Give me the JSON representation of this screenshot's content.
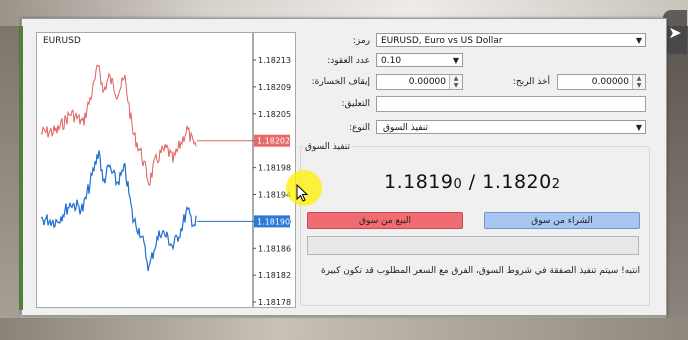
{
  "window": {
    "chart": {
      "symbol_title": "EURUSD",
      "price_axis": [
        "1.18213",
        "1.18209",
        "1.18205",
        "1.18202",
        "1.18198",
        "1.18194",
        "1.18190",
        "1.18186",
        "1.18182",
        "1.18178"
      ],
      "bid_tag": "1.18202",
      "ask_tag": "1.18190",
      "colors": {
        "bid": "#e06060",
        "ask": "#1f6fd0",
        "bid_tag_bg": "#e86a6a",
        "ask_tag_bg": "#2a7ad8"
      }
    },
    "form": {
      "symbol_label": ":رمز",
      "symbol_value": "EURUSD, Euro vs US Dollar",
      "volume_label": ":عدد العقود",
      "volume_value": "0.10",
      "stoploss_label": ":إيقاف الخسارة",
      "stoploss_value": "0.00000",
      "takeprofit_label": ":أخذ الربح",
      "takeprofit_value": "0.00000",
      "comment_label": ":التعليق",
      "comment_value": "",
      "type_label": ":النوع",
      "type_value": "تنفيذ السوق"
    },
    "market": {
      "group_title": "تنفيذ السوق",
      "bid_main": "1.1819",
      "bid_small": "0",
      "separator": " / ",
      "ask_main": "1.1820",
      "ask_small": "2",
      "sell_label": "البيع من سوق",
      "buy_label": "الشراء من سوق",
      "warning": "انتبه! سيتم تنفيذ الصفقة في شروط السوق، الفرق مع السعر المطلوب قد تكون كبيرة"
    }
  },
  "overlay": {
    "share_icon": "send-icon",
    "cursor_highlight_color": "#fff000"
  }
}
